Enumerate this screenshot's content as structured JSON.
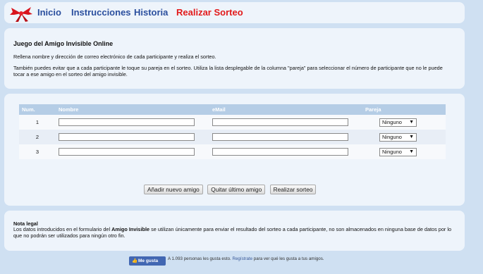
{
  "nav": {
    "links": [
      {
        "label": "Inicio"
      },
      {
        "label": "Instrucciones"
      },
      {
        "label": "Historia"
      },
      {
        "label": "Realizar Sorteo"
      }
    ]
  },
  "intro": {
    "title": "Juego del Amigo Invisible Online",
    "p1": "Rellena nombre y dirección de correo electrónico de cada participante y realiza el sorteo.",
    "p2": "También puedes evitar que a cada participante le toque su pareja en el sorteo. Utiliza la lista desplegable de la columna \"pareja\" para seleccionar el número de participante que no le puede tocar a ese amigo en el sorteo del amigo invisible."
  },
  "table": {
    "headers": [
      "Num.",
      "Nombre",
      "eMail",
      "Pareja"
    ],
    "rows": [
      {
        "num": "1",
        "nombre": "",
        "email": "",
        "pareja": "Ninguno"
      },
      {
        "num": "2",
        "nombre": "",
        "email": "",
        "pareja": "Ninguno"
      },
      {
        "num": "3",
        "nombre": "",
        "email": "",
        "pareja": "Ninguno"
      }
    ]
  },
  "buttons": {
    "add": "Añadir nuevo amigo",
    "remove": "Quitar último amigo",
    "draw": "Realizar sorteo"
  },
  "legal": {
    "title": "Nota legal",
    "before": "Los datos introducidos en el formulario del ",
    "bold": "Amigo Invisible",
    "after": " se utilizan únicamente para enviar el resultado del sorteo a cada participante, no son almacenados en ninguna base de datos por lo que no podrán ser utilizados para ningún otro fin."
  },
  "social": {
    "like_label": "Me gusta",
    "text_before": "A 1.093 personas les gusta esto. ",
    "register_link": "Regístrate",
    "text_after": " para ver qué les gusta a tus amigos."
  },
  "colors": {
    "nav_link": "#2b4f9e",
    "nav_active": "#e21a1a",
    "table_header": "#b5cde6",
    "facebook": "#4267b2"
  }
}
